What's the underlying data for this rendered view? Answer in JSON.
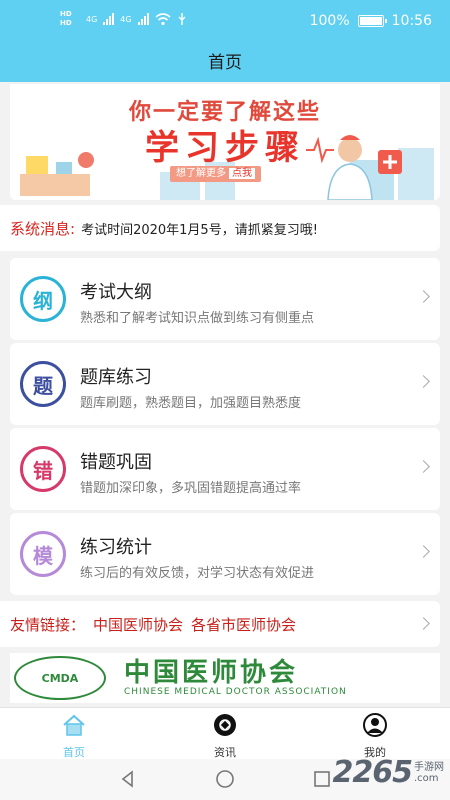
{
  "status_bar": {
    "hd1": "HD",
    "hd2": "HD",
    "net1": "4G",
    "net2": "4G",
    "battery": "100%",
    "time": "10:56"
  },
  "header": {
    "title": "首页"
  },
  "banner": {
    "line1": "你一定要了解这些",
    "line2": "学习步骤",
    "button_text": "想了解更多",
    "button_action": "点我"
  },
  "system_message": {
    "label": "系统消息:",
    "text": "考试时间2020年1月5号，请抓紧复习哦!"
  },
  "cards": [
    {
      "icon_char": "纲",
      "title": "考试大纲",
      "desc": "熟悉和了解考试知识点做到练习有侧重点",
      "color": "#2bb3d6"
    },
    {
      "icon_char": "题",
      "title": "题库练习",
      "desc": "题库刷题，熟悉题目，加强题目熟悉度",
      "color": "#3c4fa0"
    },
    {
      "icon_char": "错",
      "title": "错题巩固",
      "desc": "错题加深印象，多巩固错题提高通过率",
      "color": "#d63a6a"
    },
    {
      "icon_char": "模",
      "title": "练习统计",
      "desc": "练习后的有效反馈，对学习状态有效促进",
      "color": "#b58ad8"
    }
  ],
  "friend_links": {
    "label": "友情链接：",
    "items": [
      "中国医师协会",
      "各省市医师协会"
    ]
  },
  "logo_banner": {
    "seal": "CMDA",
    "cn_name": "中国医师协会",
    "en_name": "CHINESE MEDICAL DOCTOR ASSOCIATION"
  },
  "tabs": [
    {
      "label": "首页",
      "icon": "home-icon",
      "active": true
    },
    {
      "label": "资讯",
      "icon": "aperture-icon",
      "active": false
    },
    {
      "label": "我的",
      "icon": "user-icon",
      "active": false
    }
  ],
  "watermark": {
    "number": "2265",
    "suffix": "手游网",
    "dot": ".com"
  },
  "colors": {
    "header_bg": "#5fd0f2",
    "accent": "#5fc5ea",
    "alert_red": "#d9231d"
  }
}
